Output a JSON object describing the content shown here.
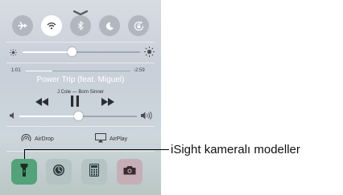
{
  "control_center": {
    "toggles": [
      {
        "name": "airplane-mode",
        "icon": "airplane-icon",
        "active": false
      },
      {
        "name": "wifi",
        "icon": "wifi-icon",
        "active": true
      },
      {
        "name": "bluetooth",
        "icon": "bluetooth-icon",
        "active": false
      },
      {
        "name": "do-not-disturb",
        "icon": "moon-icon",
        "active": false
      },
      {
        "name": "rotation-lock",
        "icon": "rotation-lock-icon",
        "active": false
      }
    ],
    "brightness": {
      "level": 0.42
    },
    "now_playing": {
      "elapsed": "1:01",
      "remaining": "-2:59",
      "progress": 0.25,
      "title": "Power Trip (feat. Miguel)",
      "artist_album": "J Cole — Born Sinner"
    },
    "volume": {
      "level": 0.5
    },
    "share": {
      "airdrop_label": "AirDrop",
      "airplay_label": "AirPlay"
    },
    "quick_apps": [
      {
        "name": "flashlight",
        "icon": "flashlight-icon",
        "active": true
      },
      {
        "name": "timer",
        "icon": "timer-icon",
        "active": false
      },
      {
        "name": "calculator",
        "icon": "calculator-icon",
        "active": false
      },
      {
        "name": "camera",
        "icon": "camera-icon",
        "active": false
      }
    ],
    "colors": {
      "active_app_bg": "#53a27a",
      "app_bg": "#b5c3c3",
      "camera_bg": "#c6aeb7"
    }
  },
  "callout": {
    "text": "iSight kameralı modeller"
  }
}
